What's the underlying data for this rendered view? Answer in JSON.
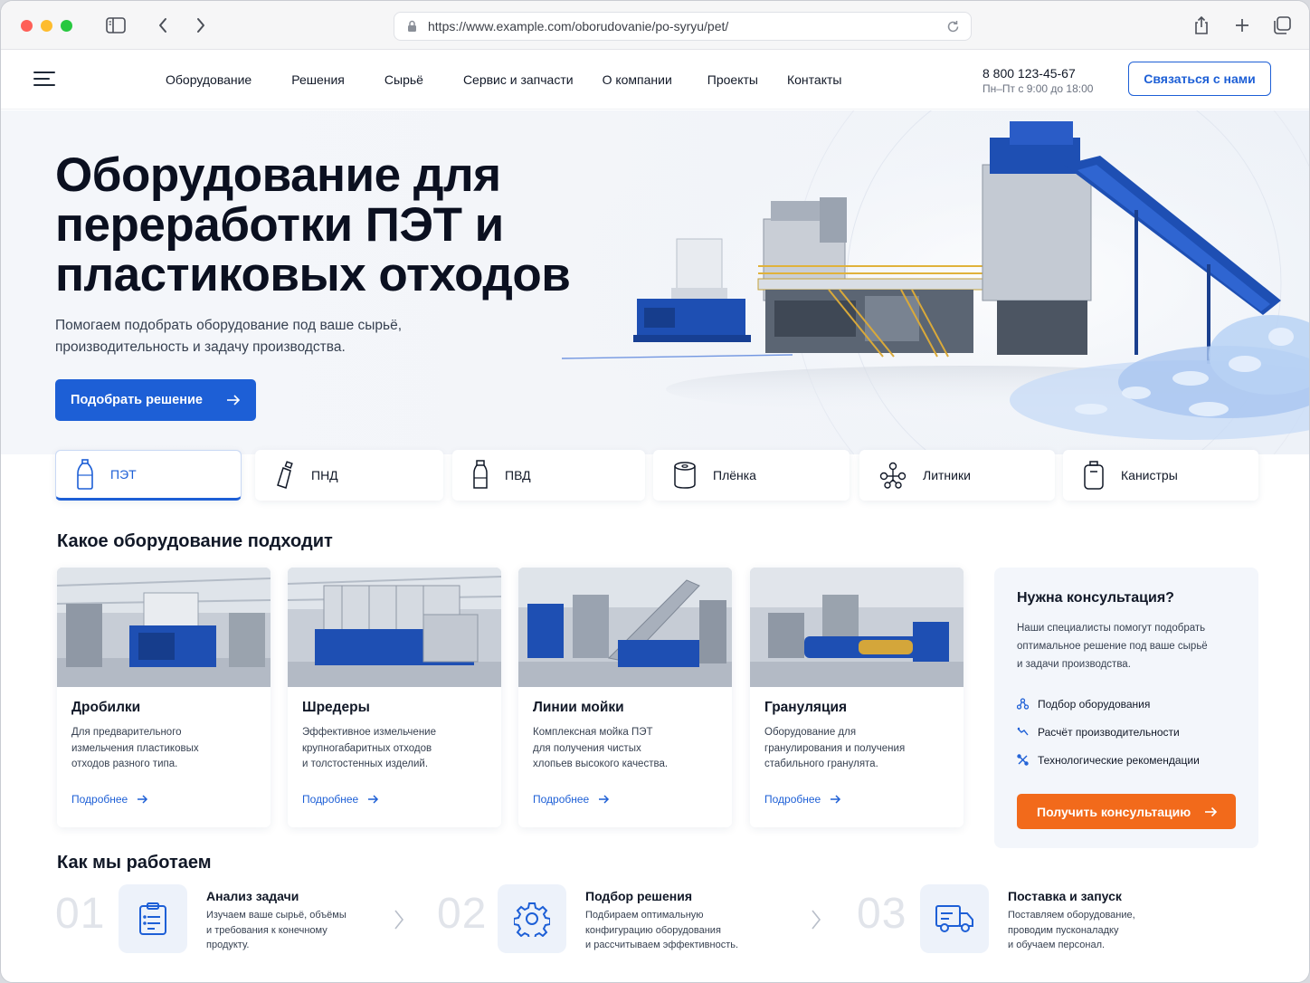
{
  "browser": {
    "url": "https://www.example.com/oborudovanie/po-syryu/pet/"
  },
  "header": {
    "nav": [
      "Оборудование",
      "Решения",
      "Сырьё",
      "Сервис и запчасти",
      "О компании",
      "Проекты",
      "Контакты"
    ],
    "phone": "8 800 123-45-67",
    "hours": "Пн–Пт с 9:00 до 18:00",
    "contact_button": "Связаться с нами"
  },
  "hero": {
    "title_lines": [
      "Оборудование для",
      "переработки ПЭТ и",
      "пластиковых отходов"
    ],
    "lead_lines": [
      "Помогаем подобрать оборудование под ваше сырьё,",
      "производительность и задачу производства."
    ],
    "button": "Подобрать решение"
  },
  "materials": [
    {
      "label": "ПЭТ",
      "icon": "bottle-icon",
      "active": true
    },
    {
      "label": "ПНД",
      "icon": "canister-bottle-icon",
      "active": false
    },
    {
      "label": "ПВД",
      "icon": "small-bottle-icon",
      "active": false
    },
    {
      "label": "Плёнка",
      "icon": "film-roll-icon",
      "active": false
    },
    {
      "label": "Литники",
      "icon": "sprue-icon",
      "active": false
    },
    {
      "label": "Канистры",
      "icon": "jerrycan-icon",
      "active": false
    }
  ],
  "equipment_section": {
    "title": "Какое оборудование подходит",
    "cards": [
      {
        "title": "Дробилки",
        "text_lines": [
          "Для предварительного",
          "измельчения пластиковых",
          "отходов разного типа."
        ],
        "link": "Подробнее"
      },
      {
        "title": "Шредеры",
        "text_lines": [
          "Эффективное измельчение",
          "крупногабаритных отходов",
          "и толстостенных изделий."
        ],
        "link": "Подробнее"
      },
      {
        "title": "Линии мойки",
        "text_lines": [
          "Комплексная мойка ПЭТ",
          "для получения чистых",
          "хлопьев высокого качества."
        ],
        "link": "Подробнее"
      },
      {
        "title": "Грануляция",
        "text_lines": [
          "Оборудование для",
          "гранулирования и получения",
          "стабильного гранулята."
        ],
        "link": "Подробнее"
      }
    ]
  },
  "consult": {
    "title": "Нужна консультация?",
    "text_lines": [
      "Наши специалисты помогут подобрать",
      "оптимальное решение под ваше сырьё",
      "и задачи производства."
    ],
    "items": [
      "Подбор оборудования",
      "Расчёт производительности",
      "Технологические рекомендации"
    ],
    "button": "Получить консультацию"
  },
  "steps_section": {
    "title": "Как мы работаем",
    "steps": [
      {
        "num": "01",
        "title": "Анализ задачи",
        "icon": "clipboard-icon",
        "text_lines": [
          "Изучаем ваше сырьё, объёмы",
          "и требования к конечному",
          "продукту."
        ]
      },
      {
        "num": "02",
        "title": "Подбор решения",
        "icon": "gear-icon",
        "text_lines": [
          "Подбираем оптимальную",
          "конфигурацию оборудования",
          "и рассчитываем эффективность."
        ]
      },
      {
        "num": "03",
        "title": "Поставка и запуск",
        "icon": "truck-icon",
        "text_lines": [
          "Поставляем оборудование,",
          "проводим пусконаладку",
          "и обучаем персонал."
        ]
      }
    ]
  },
  "colors": {
    "primary": "#1d5fd6",
    "accent_orange": "#f26a1b",
    "machine_blue": "#1e4fb3"
  }
}
